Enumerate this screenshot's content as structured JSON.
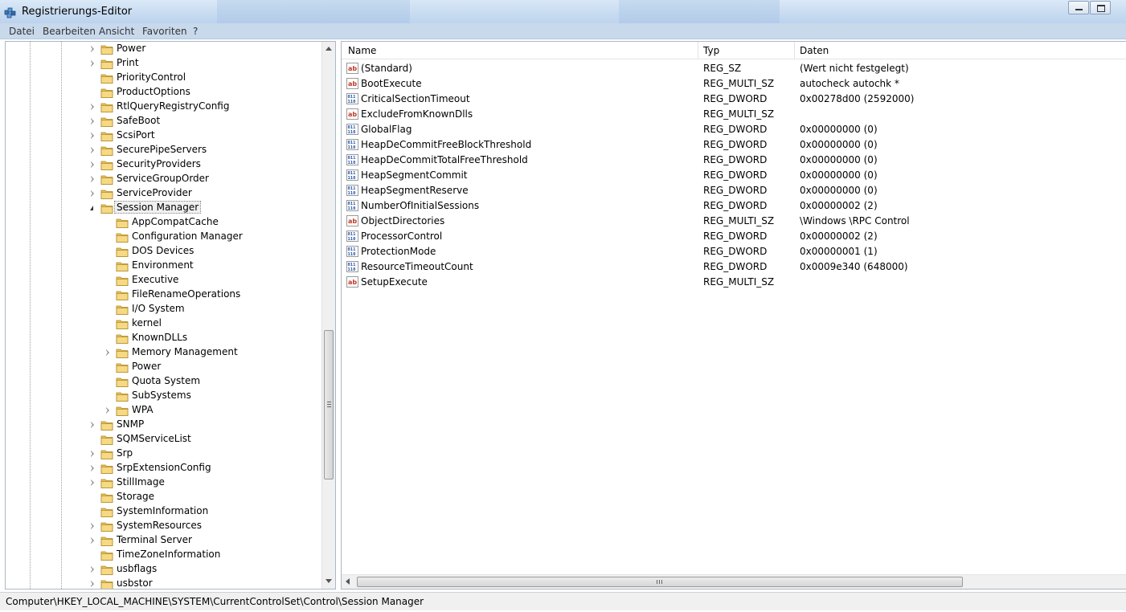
{
  "window": {
    "title": "Registrierungs-Editor"
  },
  "menu": [
    "Datei",
    "Bearbeiten",
    "Ansicht",
    "Favoriten",
    "?"
  ],
  "tree": [
    {
      "label": "Power",
      "level": 0,
      "expander": "closed"
    },
    {
      "label": "Print",
      "level": 0,
      "expander": "closed"
    },
    {
      "label": "PriorityControl",
      "level": 0,
      "expander": "none"
    },
    {
      "label": "ProductOptions",
      "level": 0,
      "expander": "none"
    },
    {
      "label": "RtlQueryRegistryConfig",
      "level": 0,
      "expander": "closed"
    },
    {
      "label": "SafeBoot",
      "level": 0,
      "expander": "closed"
    },
    {
      "label": "ScsiPort",
      "level": 0,
      "expander": "closed"
    },
    {
      "label": "SecurePipeServers",
      "level": 0,
      "expander": "closed"
    },
    {
      "label": "SecurityProviders",
      "level": 0,
      "expander": "closed"
    },
    {
      "label": "ServiceGroupOrder",
      "level": 0,
      "expander": "closed"
    },
    {
      "label": "ServiceProvider",
      "level": 0,
      "expander": "closed"
    },
    {
      "label": "Session Manager",
      "level": 0,
      "expander": "open",
      "selected": true
    },
    {
      "label": "AppCompatCache",
      "level": 1,
      "expander": "none"
    },
    {
      "label": "Configuration Manager",
      "level": 1,
      "expander": "none"
    },
    {
      "label": "DOS Devices",
      "level": 1,
      "expander": "none"
    },
    {
      "label": "Environment",
      "level": 1,
      "expander": "none"
    },
    {
      "label": "Executive",
      "level": 1,
      "expander": "none"
    },
    {
      "label": "FileRenameOperations",
      "level": 1,
      "expander": "none"
    },
    {
      "label": "I/O System",
      "level": 1,
      "expander": "none"
    },
    {
      "label": "kernel",
      "level": 1,
      "expander": "none"
    },
    {
      "label": "KnownDLLs",
      "level": 1,
      "expander": "none"
    },
    {
      "label": "Memory Management",
      "level": 1,
      "expander": "closed"
    },
    {
      "label": "Power",
      "level": 1,
      "expander": "none"
    },
    {
      "label": "Quota System",
      "level": 1,
      "expander": "none"
    },
    {
      "label": "SubSystems",
      "level": 1,
      "expander": "none"
    },
    {
      "label": "WPA",
      "level": 1,
      "expander": "closed"
    },
    {
      "label": "SNMP",
      "level": 0,
      "expander": "closed"
    },
    {
      "label": "SQMServiceList",
      "level": 0,
      "expander": "none"
    },
    {
      "label": "Srp",
      "level": 0,
      "expander": "closed"
    },
    {
      "label": "SrpExtensionConfig",
      "level": 0,
      "expander": "closed"
    },
    {
      "label": "StillImage",
      "level": 0,
      "expander": "closed"
    },
    {
      "label": "Storage",
      "level": 0,
      "expander": "none"
    },
    {
      "label": "SystemInformation",
      "level": 0,
      "expander": "none"
    },
    {
      "label": "SystemResources",
      "level": 0,
      "expander": "closed"
    },
    {
      "label": "Terminal Server",
      "level": 0,
      "expander": "closed"
    },
    {
      "label": "TimeZoneInformation",
      "level": 0,
      "expander": "none"
    },
    {
      "label": "usbflags",
      "level": 0,
      "expander": "closed"
    },
    {
      "label": "usbstor",
      "level": 0,
      "expander": "closed"
    }
  ],
  "list": {
    "columns": [
      "Name",
      "Typ",
      "Daten"
    ],
    "rows": [
      {
        "icon": "string-value-icon",
        "name": "(Standard)",
        "type": "REG_SZ",
        "data": "(Wert nicht festgelegt)"
      },
      {
        "icon": "string-value-icon",
        "name": "BootExecute",
        "type": "REG_MULTI_SZ",
        "data": "autocheck autochk *"
      },
      {
        "icon": "binary-value-icon",
        "name": "CriticalSectionTimeout",
        "type": "REG_DWORD",
        "data": "0x00278d00 (2592000)"
      },
      {
        "icon": "string-value-icon",
        "name": "ExcludeFromKnownDlls",
        "type": "REG_MULTI_SZ",
        "data": ""
      },
      {
        "icon": "binary-value-icon",
        "name": "GlobalFlag",
        "type": "REG_DWORD",
        "data": "0x00000000 (0)"
      },
      {
        "icon": "binary-value-icon",
        "name": "HeapDeCommitFreeBlockThreshold",
        "type": "REG_DWORD",
        "data": "0x00000000 (0)"
      },
      {
        "icon": "binary-value-icon",
        "name": "HeapDeCommitTotalFreeThreshold",
        "type": "REG_DWORD",
        "data": "0x00000000 (0)"
      },
      {
        "icon": "binary-value-icon",
        "name": "HeapSegmentCommit",
        "type": "REG_DWORD",
        "data": "0x00000000 (0)"
      },
      {
        "icon": "binary-value-icon",
        "name": "HeapSegmentReserve",
        "type": "REG_DWORD",
        "data": "0x00000000 (0)"
      },
      {
        "icon": "binary-value-icon",
        "name": "NumberOfInitialSessions",
        "type": "REG_DWORD",
        "data": "0x00000002 (2)"
      },
      {
        "icon": "string-value-icon",
        "name": "ObjectDirectories",
        "type": "REG_MULTI_SZ",
        "data": "\\Windows \\RPC Control"
      },
      {
        "icon": "binary-value-icon",
        "name": "ProcessorControl",
        "type": "REG_DWORD",
        "data": "0x00000002 (2)"
      },
      {
        "icon": "binary-value-icon",
        "name": "ProtectionMode",
        "type": "REG_DWORD",
        "data": "0x00000001 (1)"
      },
      {
        "icon": "binary-value-icon",
        "name": "ResourceTimeoutCount",
        "type": "REG_DWORD",
        "data": "0x0009e340 (648000)"
      },
      {
        "icon": "string-value-icon",
        "name": "SetupExecute",
        "type": "REG_MULTI_SZ",
        "data": ""
      }
    ]
  },
  "status": {
    "path": "Computer\\HKEY_LOCAL_MACHINE\\SYSTEM\\CurrentControlSet\\Control\\Session Manager"
  }
}
